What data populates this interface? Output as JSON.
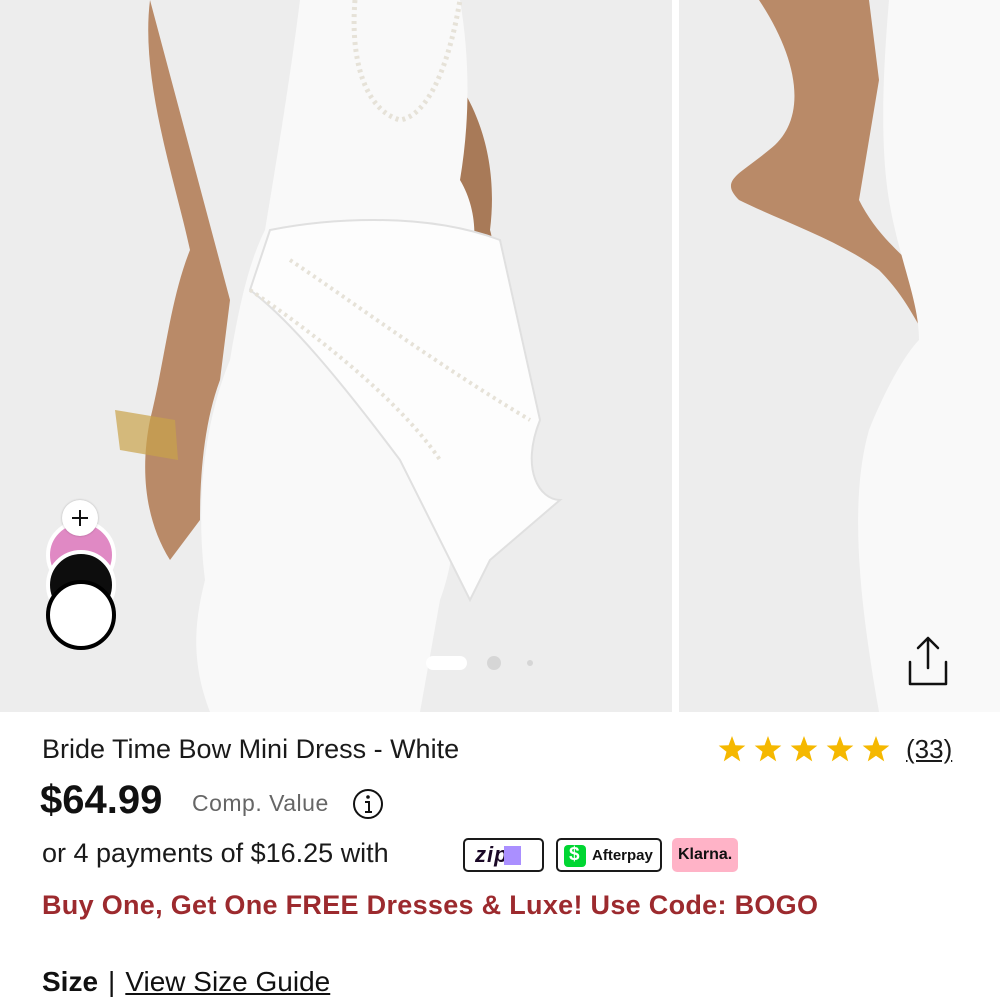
{
  "product": {
    "title": "Bride Time Bow Mini Dress - White",
    "price": "$64.99",
    "comp_value_label": "Comp. Value",
    "rating_stars": 5,
    "review_count": "(33)",
    "payments_text": "or 4 payments of $16.25 with",
    "promo_text": "Buy One, Get One FREE Dresses & Luxe! Use Code: BOGO",
    "size_label": "Size",
    "size_separator": "|",
    "size_guide_link": "View Size Guide"
  },
  "payment_badges": {
    "zip": "zip",
    "afterpay": "Afterpay",
    "cashapp_symbol": "$",
    "klarna": "Klarna."
  },
  "gallery": {
    "current_slide": 1,
    "total_slides": 3
  },
  "swatches": [
    {
      "name": "pink",
      "color": "#e089c4"
    },
    {
      "name": "black",
      "color": "#0d0d0d"
    },
    {
      "name": "white",
      "color": "#ffffff"
    }
  ],
  "colors": {
    "promo": "#9c2a2e",
    "star": "#f5b800",
    "zip_brand": "#aa8fff",
    "cashapp_green": "#00d632",
    "klarna_pink": "#ffb3c7"
  },
  "icons": {
    "add_swatch": "plus-icon",
    "share": "share-icon",
    "info": "info-icon",
    "star": "star-icon"
  }
}
